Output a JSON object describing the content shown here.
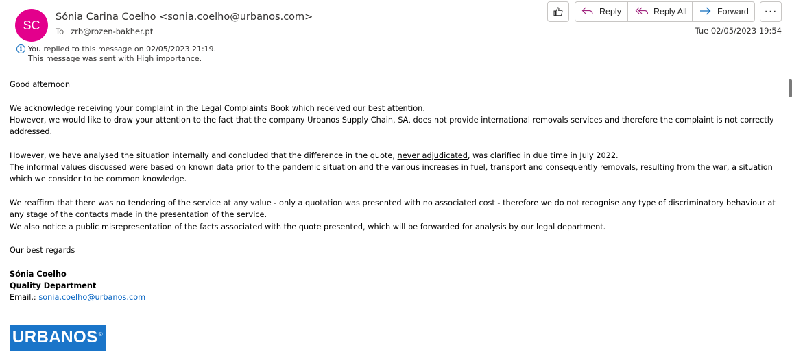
{
  "message": {
    "avatar_initials": "SC",
    "avatar_color": "#e3008c",
    "sender": "Sónia Carina Coelho <sonia.coelho@urbanos.com>",
    "to_label": "To",
    "to_address": "zrb@rozen-bakher.pt",
    "date": "Tue 02/05/2023 19:54",
    "info_line1": "You replied to this message on 02/05/2023 21:19.",
    "info_line2": "This message was sent with High importance."
  },
  "toolbar": {
    "like_icon": "thumbs-up-icon",
    "reply_label": "Reply",
    "reply_all_label": "Reply All",
    "forward_label": "Forward",
    "more_label": "···"
  },
  "body": {
    "greeting": "Good afternoon",
    "p1_l1": "We acknowledge receiving your complaint in the Legal Complaints Book which received our best attention.",
    "p1_l2": "However, we would like to draw your attention to the fact that the company Urbanos Supply Chain, SA, does not provide international removals services and therefore the complaint is not correctly addressed.",
    "p2_a": "However, we have analysed the situation internally and concluded that the difference in the quote, ",
    "p2_underlined": "never adjudicated",
    "p2_b": ", was clarified in due time in July 2022.",
    "p2_l2": "The informal values discussed were based on known data prior to the pandemic situation and the various increases in fuel, transport and consequently removals, resulting from the war, a situation which we consider to be common knowledge.",
    "p3_l1": "We reaffirm that there was no tendering of the service at any value - only a quotation was presented with no associated cost - therefore we do not recognise any type of discriminatory behaviour at any stage of the contacts made in the presentation of the service.",
    "p3_l2": "We also notice a public misrepresentation of the facts associated with the quote presented, which will be forwarded for analysis by our legal department.",
    "closing": "Our best regards",
    "sig_name": "Sónia Coelho",
    "sig_dept": "Quality Department",
    "sig_email_label": "Email.: ",
    "sig_email": "sonia.coelho@urbanos.com"
  },
  "logo": {
    "text": "URBANOS",
    "mark": "®",
    "color": "#1a75c9"
  }
}
